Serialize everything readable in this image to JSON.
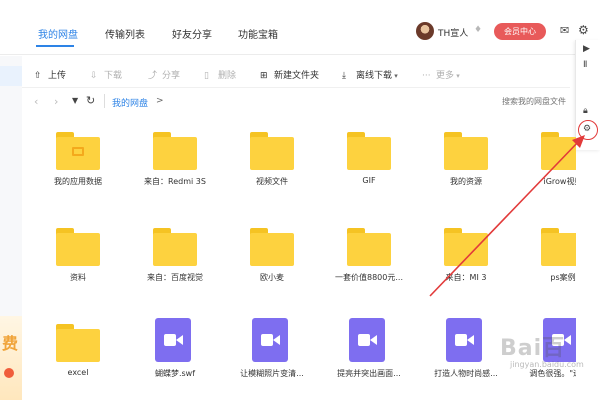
{
  "nav": {
    "tabs": [
      "我的网盘",
      "传输列表",
      "好友分享",
      "功能宝箱"
    ],
    "username": "TH宣人",
    "vip_button": "会员中心"
  },
  "toolbar": {
    "items": [
      {
        "label": "上传",
        "icon": "upload-icon",
        "enabled": true
      },
      {
        "label": "下载",
        "icon": "download-icon",
        "enabled": false
      },
      {
        "label": "分享",
        "icon": "share-icon",
        "enabled": false
      },
      {
        "label": "删除",
        "icon": "delete-icon",
        "enabled": false
      },
      {
        "label": "新建文件夹",
        "icon": "new-folder-icon",
        "enabled": true
      },
      {
        "label": "离线下载",
        "icon": "offline-download-icon",
        "enabled": true
      },
      {
        "label": "更多",
        "icon": "more-icon",
        "enabled": false
      }
    ]
  },
  "path": {
    "crumb": "我的网盘",
    "arrow": ">",
    "search_placeholder": "搜索我的网盘文件"
  },
  "files": [
    {
      "name": "我的应用数据",
      "type": "folder-app"
    },
    {
      "name": "来自：Redmi 3S",
      "type": "folder"
    },
    {
      "name": "视频文件",
      "type": "folder"
    },
    {
      "name": "GIF",
      "type": "folder"
    },
    {
      "name": "我的资源",
      "type": "folder"
    },
    {
      "name": "iGrow视频",
      "type": "folder"
    },
    {
      "name": "资料",
      "type": "folder"
    },
    {
      "name": "来自：百度视觉",
      "type": "folder"
    },
    {
      "name": "欧小麦",
      "type": "folder"
    },
    {
      "name": "一套价值8800元...",
      "type": "folder"
    },
    {
      "name": "来自：MI 3",
      "type": "folder"
    },
    {
      "name": "ps案例",
      "type": "folder"
    },
    {
      "name": "excel",
      "type": "folder"
    },
    {
      "name": "蝴蝶梦.swf",
      "type": "video"
    },
    {
      "name": "让模糊照片变清...",
      "type": "video"
    },
    {
      "name": "提亮并突出画面...",
      "type": "video"
    },
    {
      "name": "打造人物时尚感...",
      "type": "video"
    },
    {
      "name": "调色很强。\"速成...",
      "type": "video"
    }
  ],
  "watermark": {
    "text": "Bai百",
    "sub": "jingyan.baidu.com"
  },
  "colors": {
    "accent": "#2d83e6",
    "folder": "#fdd23f",
    "video": "#7e6ef0",
    "vip": "#e85a5a",
    "annotation": "#e23a3a"
  }
}
